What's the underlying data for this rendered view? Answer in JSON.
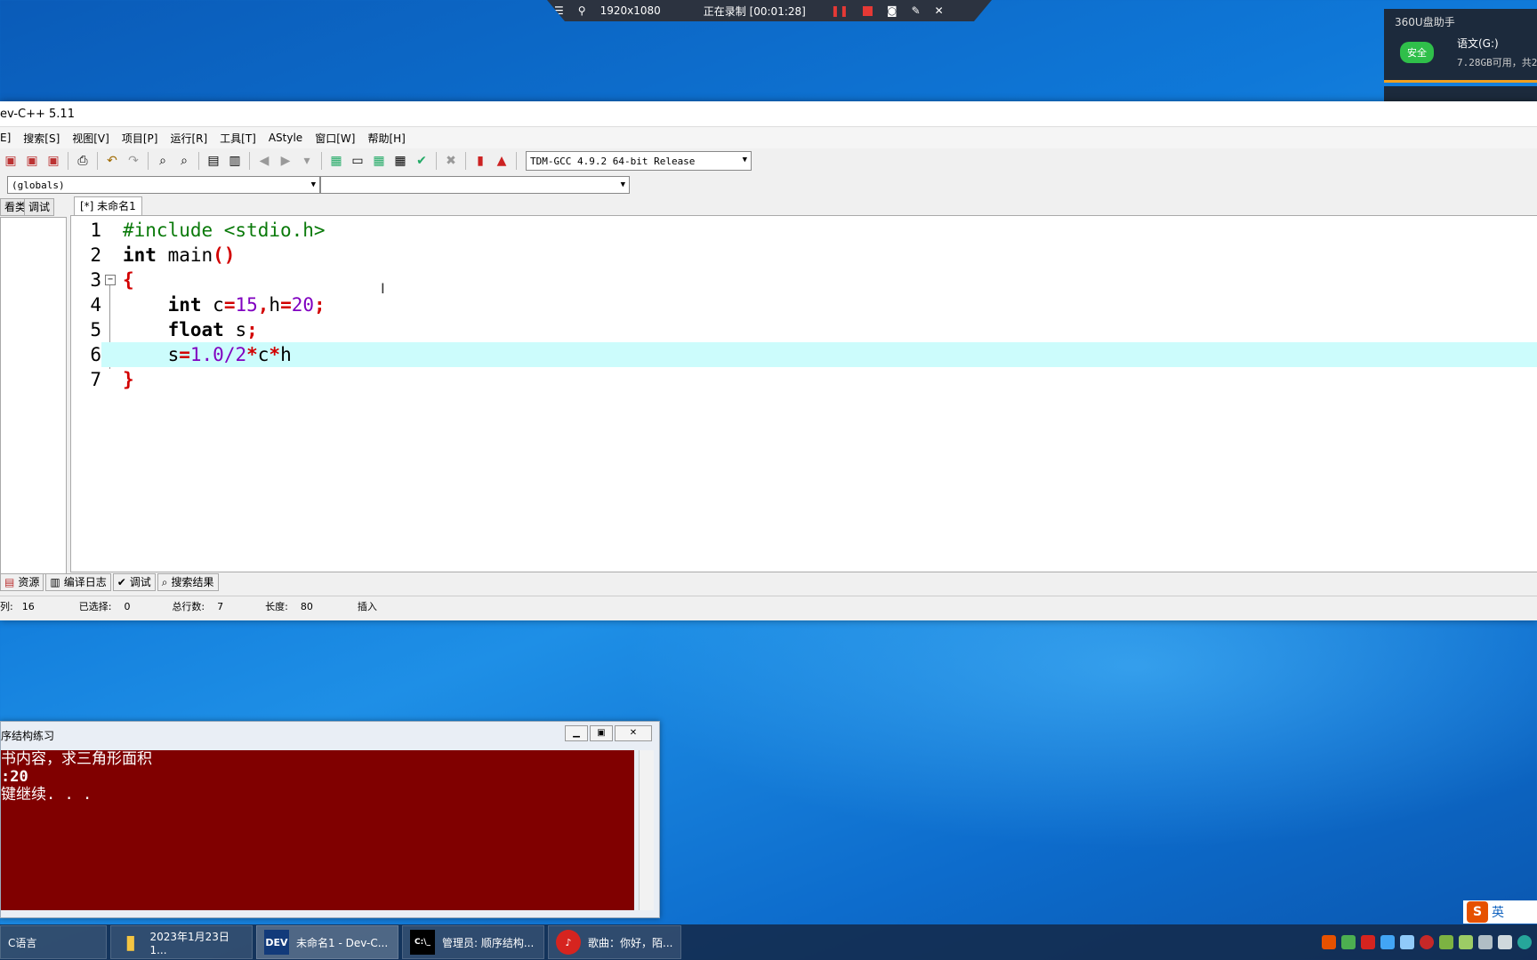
{
  "recorder": {
    "resolution": "1920x1080",
    "status": "正在录制 [00:01:28]"
  },
  "usb_widget": {
    "title": "360U盘助手",
    "badge": "安全",
    "drive": "语文(G:)",
    "free": "7.28GB可用，共2"
  },
  "devcpp": {
    "title": "ev-C++ 5.11",
    "menu": [
      "E]",
      "搜索[S]",
      "视图[V]",
      "项目[P]",
      "运行[R]",
      "工具[T]",
      "AStyle",
      "窗口[W]",
      "帮助[H]"
    ],
    "compiler": "TDM-GCC 4.9.2 64-bit Release",
    "scope": "(globals)",
    "scope2": "",
    "left_tabs": [
      "看类",
      "调试"
    ],
    "editor_tab": "[*] 未命名1",
    "lines": {
      "n1": "1",
      "n2": "2",
      "n3": "3",
      "n4": "4",
      "n5": "5",
      "n6": "6",
      "n7": "7",
      "l1": "#include <stdio.h>",
      "l2_kw": "int",
      "l2_rest": " main",
      "l2_paren": "()",
      "l3": "{",
      "l4_indent": "    ",
      "l4_kw": "int",
      "l4_a": " c",
      "l4_eq1": "=",
      "l4_n1": "15",
      "l4_comma": ",",
      "l4_h": "h",
      "l4_eq2": "=",
      "l4_n2": "20",
      "l4_semi": ";",
      "l5_indent": "    ",
      "l5_kw": "float",
      "l5_a": " s",
      "l5_semi": ";",
      "l6_indent": "    ",
      "l6_s": "s",
      "l6_eq": "=",
      "l6_num": "1.0/2",
      "l6_op1": "*",
      "l6_c": "c",
      "l6_op2": "*",
      "l6_h": "h",
      "l7": "}"
    },
    "bottom_tabs": [
      "资源",
      "编译日志",
      "调试",
      "搜索结果"
    ],
    "status": {
      "col_label": "列:",
      "col": "16",
      "sel_label": "已选择:",
      "sel": "0",
      "lines_label": "总行数:",
      "lines": "7",
      "len_label": "长度:",
      "len": "80",
      "mode": "插入"
    }
  },
  "console": {
    "title": "序结构练习",
    "line1": "书内容，求三角形面积",
    "line2": ":20",
    "line3": "键继续. . ."
  },
  "taskbar": {
    "items": [
      "C语言",
      "2023年1月23日1...",
      "未命名1 - Dev-C...",
      "管理员: 顺序结构...",
      "歌曲：你好，陌..."
    ],
    "dev_icon": "DEV",
    "cmd_icon": "C:\\_"
  },
  "ime": {
    "logo": "S",
    "lang": "英"
  }
}
